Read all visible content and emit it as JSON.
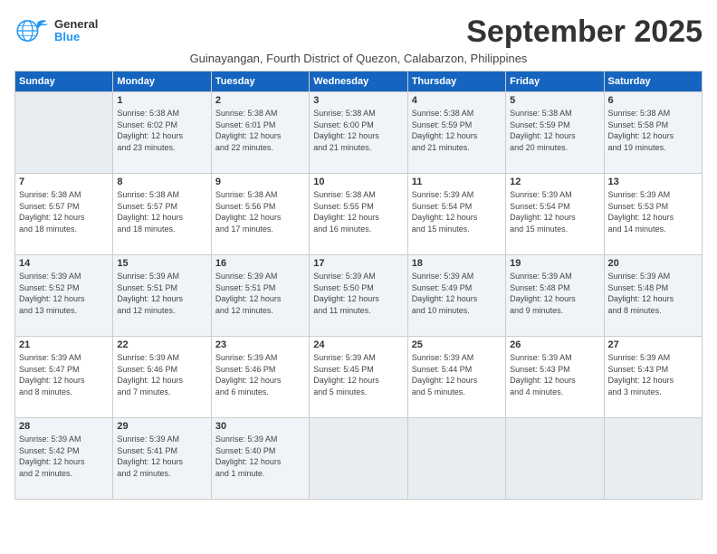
{
  "header": {
    "logo_general": "General",
    "logo_blue": "Blue",
    "month": "September 2025",
    "location": "Guinayangan, Fourth District of Quezon, Calabarzon, Philippines"
  },
  "days_of_week": [
    "Sunday",
    "Monday",
    "Tuesday",
    "Wednesday",
    "Thursday",
    "Friday",
    "Saturday"
  ],
  "weeks": [
    [
      {
        "day": "",
        "info": ""
      },
      {
        "day": "1",
        "info": "Sunrise: 5:38 AM\nSunset: 6:02 PM\nDaylight: 12 hours\nand 23 minutes."
      },
      {
        "day": "2",
        "info": "Sunrise: 5:38 AM\nSunset: 6:01 PM\nDaylight: 12 hours\nand 22 minutes."
      },
      {
        "day": "3",
        "info": "Sunrise: 5:38 AM\nSunset: 6:00 PM\nDaylight: 12 hours\nand 21 minutes."
      },
      {
        "day": "4",
        "info": "Sunrise: 5:38 AM\nSunset: 5:59 PM\nDaylight: 12 hours\nand 21 minutes."
      },
      {
        "day": "5",
        "info": "Sunrise: 5:38 AM\nSunset: 5:59 PM\nDaylight: 12 hours\nand 20 minutes."
      },
      {
        "day": "6",
        "info": "Sunrise: 5:38 AM\nSunset: 5:58 PM\nDaylight: 12 hours\nand 19 minutes."
      }
    ],
    [
      {
        "day": "7",
        "info": "Sunrise: 5:38 AM\nSunset: 5:57 PM\nDaylight: 12 hours\nand 18 minutes."
      },
      {
        "day": "8",
        "info": "Sunrise: 5:38 AM\nSunset: 5:57 PM\nDaylight: 12 hours\nand 18 minutes."
      },
      {
        "day": "9",
        "info": "Sunrise: 5:38 AM\nSunset: 5:56 PM\nDaylight: 12 hours\nand 17 minutes."
      },
      {
        "day": "10",
        "info": "Sunrise: 5:38 AM\nSunset: 5:55 PM\nDaylight: 12 hours\nand 16 minutes."
      },
      {
        "day": "11",
        "info": "Sunrise: 5:39 AM\nSunset: 5:54 PM\nDaylight: 12 hours\nand 15 minutes."
      },
      {
        "day": "12",
        "info": "Sunrise: 5:39 AM\nSunset: 5:54 PM\nDaylight: 12 hours\nand 15 minutes."
      },
      {
        "day": "13",
        "info": "Sunrise: 5:39 AM\nSunset: 5:53 PM\nDaylight: 12 hours\nand 14 minutes."
      }
    ],
    [
      {
        "day": "14",
        "info": "Sunrise: 5:39 AM\nSunset: 5:52 PM\nDaylight: 12 hours\nand 13 minutes."
      },
      {
        "day": "15",
        "info": "Sunrise: 5:39 AM\nSunset: 5:51 PM\nDaylight: 12 hours\nand 12 minutes."
      },
      {
        "day": "16",
        "info": "Sunrise: 5:39 AM\nSunset: 5:51 PM\nDaylight: 12 hours\nand 12 minutes."
      },
      {
        "day": "17",
        "info": "Sunrise: 5:39 AM\nSunset: 5:50 PM\nDaylight: 12 hours\nand 11 minutes."
      },
      {
        "day": "18",
        "info": "Sunrise: 5:39 AM\nSunset: 5:49 PM\nDaylight: 12 hours\nand 10 minutes."
      },
      {
        "day": "19",
        "info": "Sunrise: 5:39 AM\nSunset: 5:48 PM\nDaylight: 12 hours\nand 9 minutes."
      },
      {
        "day": "20",
        "info": "Sunrise: 5:39 AM\nSunset: 5:48 PM\nDaylight: 12 hours\nand 8 minutes."
      }
    ],
    [
      {
        "day": "21",
        "info": "Sunrise: 5:39 AM\nSunset: 5:47 PM\nDaylight: 12 hours\nand 8 minutes."
      },
      {
        "day": "22",
        "info": "Sunrise: 5:39 AM\nSunset: 5:46 PM\nDaylight: 12 hours\nand 7 minutes."
      },
      {
        "day": "23",
        "info": "Sunrise: 5:39 AM\nSunset: 5:46 PM\nDaylight: 12 hours\nand 6 minutes."
      },
      {
        "day": "24",
        "info": "Sunrise: 5:39 AM\nSunset: 5:45 PM\nDaylight: 12 hours\nand 5 minutes."
      },
      {
        "day": "25",
        "info": "Sunrise: 5:39 AM\nSunset: 5:44 PM\nDaylight: 12 hours\nand 5 minutes."
      },
      {
        "day": "26",
        "info": "Sunrise: 5:39 AM\nSunset: 5:43 PM\nDaylight: 12 hours\nand 4 minutes."
      },
      {
        "day": "27",
        "info": "Sunrise: 5:39 AM\nSunset: 5:43 PM\nDaylight: 12 hours\nand 3 minutes."
      }
    ],
    [
      {
        "day": "28",
        "info": "Sunrise: 5:39 AM\nSunset: 5:42 PM\nDaylight: 12 hours\nand 2 minutes."
      },
      {
        "day": "29",
        "info": "Sunrise: 5:39 AM\nSunset: 5:41 PM\nDaylight: 12 hours\nand 2 minutes."
      },
      {
        "day": "30",
        "info": "Sunrise: 5:39 AM\nSunset: 5:40 PM\nDaylight: 12 hours\nand 1 minute."
      },
      {
        "day": "",
        "info": ""
      },
      {
        "day": "",
        "info": ""
      },
      {
        "day": "",
        "info": ""
      },
      {
        "day": "",
        "info": ""
      }
    ]
  ]
}
